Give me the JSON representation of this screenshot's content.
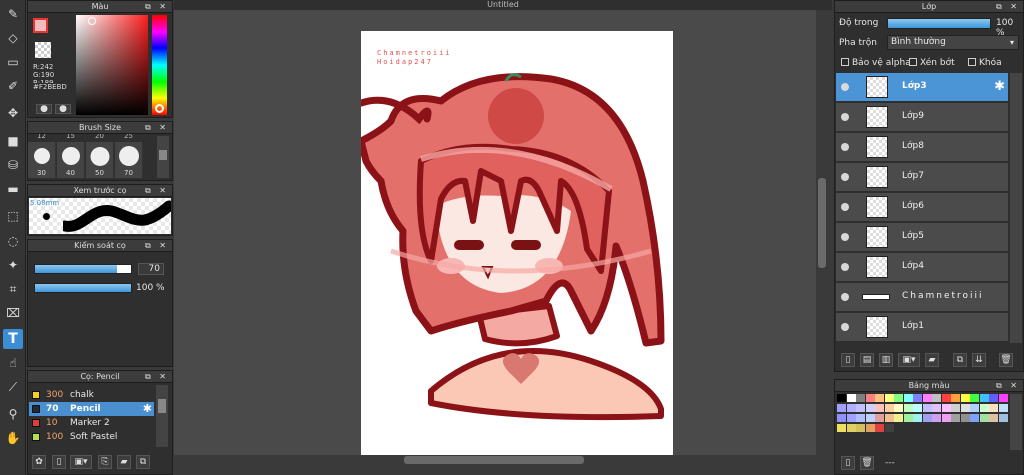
{
  "document": {
    "title": "Untitled"
  },
  "color_panel": {
    "title": "Màu",
    "r": "R:242",
    "g": "G:190",
    "b": "B:189",
    "hex": "#F2BEBD",
    "foreground": "#f2bebd",
    "background": "#ffffff"
  },
  "brush_size_panel": {
    "title": "Brush Size",
    "top_sizes": [
      "12",
      "15",
      "20",
      "25"
    ],
    "sizes": [
      "30",
      "40",
      "50",
      "70"
    ]
  },
  "brush_preview_panel": {
    "title": "Xem trước cọ",
    "size_label": "5.08mm"
  },
  "brush_control_panel": {
    "title": "Kiểm soát cọ",
    "size_value": "70",
    "size_fraction": 0.85,
    "opacity_value": "100 %",
    "opacity_fraction": 1.0
  },
  "brush_list_panel": {
    "title": "Cọ: Pencil",
    "brushes": [
      {
        "num": "300",
        "name": "chalk",
        "color": "#f0d020"
      },
      {
        "num": "70",
        "name": "Pencil",
        "color": "#1d2b3a"
      },
      {
        "num": "10",
        "name": "Marker 2",
        "color": "#e23b3b"
      },
      {
        "num": "100",
        "name": "Soft Pastel",
        "color": "#b5e04a"
      }
    ]
  },
  "layer_panel": {
    "title": "Lớp",
    "opacity_label": "Độ trong",
    "opacity_value": "100 %",
    "opacity_fraction": 1.0,
    "blend_label": "Pha trộn",
    "blend_value": "Bình thường",
    "protect_alpha": "Bảo vệ alpha",
    "clipping": "Xén bớt",
    "lock": "Khóa",
    "layers": [
      "Lớp3",
      "Lớp9",
      "Lớp8",
      "Lớp7",
      "Lớp6",
      "Lớp5",
      "Lớp4",
      "Chamnetroiii",
      "Lớp1"
    ]
  },
  "palette_panel": {
    "title": "Bảng màu",
    "status": "---",
    "colors": [
      "#000000",
      "#ffffff",
      "#7f7f7f",
      "#ff8080",
      "#ffbf80",
      "#ffff80",
      "#80ff80",
      "#80ffff",
      "#8080ff",
      "#ff80ff",
      "#c0c0c0",
      "#ff4040",
      "#ffa040",
      "#ffff40",
      "#40ff40",
      "#40c0ff",
      "#6060ff",
      "#ff40ff",
      "#a0a0ff",
      "#b0b0ff",
      "#c0c0ff",
      "#d0d0ff",
      "#ffc0c0",
      "#ffd0a0",
      "#ffffc0",
      "#c0ffc0",
      "#c0ffff",
      "#c0c0ff",
      "#e0c0ff",
      "#ffc0ff",
      "#d0d0d0",
      "#e0e0e0",
      "#b0d0ff",
      "#d0ffd0",
      "#ffe0c0",
      "#c0e0ff",
      "#9090ff",
      "#a0a0ff",
      "#b0c0ff",
      "#c0d0ff",
      "#e0a0a0",
      "#f0c090",
      "#f0f090",
      "#a0f0a0",
      "#a0f0f0",
      "#a0a0f0",
      "#d0a0f0",
      "#f0a0f0",
      "#a0a0a0",
      "#909090",
      "#80a0ff",
      "#a0e0a0",
      "#e0c0a0",
      "#a0c0e0",
      "#f0e060",
      "#e0d060",
      "#d0c060",
      "#e0a060",
      "#e04040",
      "#404040"
    ]
  },
  "artwork": {
    "signature_line1": "Chamnetroiii",
    "signature_line2": "Hoidap247"
  }
}
